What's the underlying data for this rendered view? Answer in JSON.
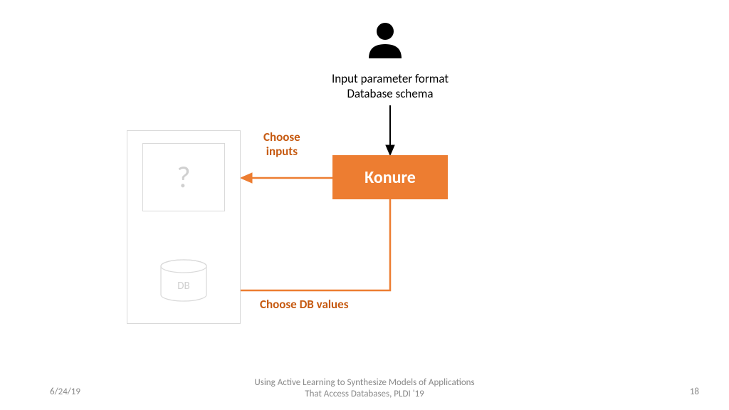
{
  "user_input_line1": "Input parameter format",
  "user_input_line2": "Database schema",
  "konure_label": "Konure",
  "choose_inputs_line1": "Choose",
  "choose_inputs_line2": "inputs",
  "choose_db_label": "Choose DB values",
  "question_mark": "?",
  "db_label": "DB",
  "footer_date": "6/24/19",
  "footer_title_line1": "Using Active Learning to Synthesize Models of Applications",
  "footer_title_line2": "That Access Databases, PLDI '19",
  "footer_page": "18",
  "colors": {
    "orange": "#ed7d31",
    "orange_dark": "#c65a11",
    "grey_border": "#d9d9d9",
    "grey_text": "#d0d0d0"
  }
}
